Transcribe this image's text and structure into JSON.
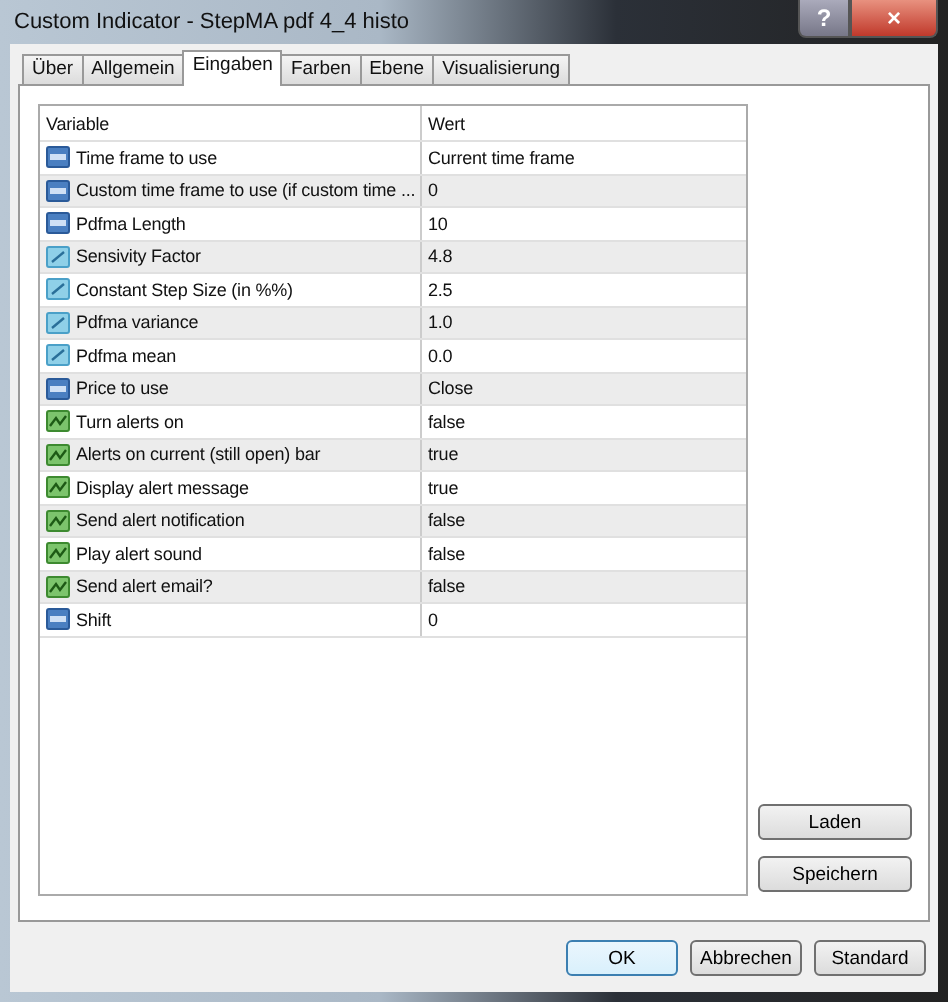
{
  "window": {
    "title": "Custom Indicator - StepMA pdf 4_4 histo",
    "help": "?",
    "close": "×"
  },
  "tabs": [
    {
      "label": "Über",
      "selected": false
    },
    {
      "label": "Allgemein",
      "selected": false
    },
    {
      "label": "Eingaben",
      "selected": true
    },
    {
      "label": "Farben",
      "selected": false
    },
    {
      "label": "Ebene",
      "selected": false
    },
    {
      "label": "Visualisierung",
      "selected": false
    }
  ],
  "table": {
    "columns": [
      "Variable",
      "Wert"
    ],
    "rows": [
      {
        "kind": "int",
        "variable": "Time frame to use",
        "value": "Current time frame"
      },
      {
        "kind": "int",
        "variable": "Custom time frame to use (if custom time ...",
        "value": "0"
      },
      {
        "kind": "int",
        "variable": "Pdfma Length",
        "value": "10"
      },
      {
        "kind": "double",
        "variable": "Sensivity Factor",
        "value": "4.8"
      },
      {
        "kind": "double",
        "variable": "Constant Step Size (in %%)",
        "value": "2.5"
      },
      {
        "kind": "double",
        "variable": "Pdfma variance",
        "value": "1.0"
      },
      {
        "kind": "double",
        "variable": "Pdfma mean",
        "value": "0.0"
      },
      {
        "kind": "int",
        "variable": "Price to use",
        "value": "Close"
      },
      {
        "kind": "bool",
        "variable": "Turn alerts on",
        "value": "false"
      },
      {
        "kind": "bool",
        "variable": "Alerts on current (still open) bar",
        "value": "true"
      },
      {
        "kind": "bool",
        "variable": "Display alert message",
        "value": "true"
      },
      {
        "kind": "bool",
        "variable": "Send alert notification",
        "value": "false"
      },
      {
        "kind": "bool",
        "variable": "Play alert sound",
        "value": "false"
      },
      {
        "kind": "bool",
        "variable": "Send alert email?",
        "value": "false"
      },
      {
        "kind": "int",
        "variable": "Shift",
        "value": "0"
      }
    ]
  },
  "side_buttons": [
    "Laden",
    "Speichern"
  ],
  "buttons": [
    {
      "label": "OK",
      "default": true
    },
    {
      "label": "Abbrechen",
      "default": false
    },
    {
      "label": "Standard",
      "default": false
    }
  ]
}
